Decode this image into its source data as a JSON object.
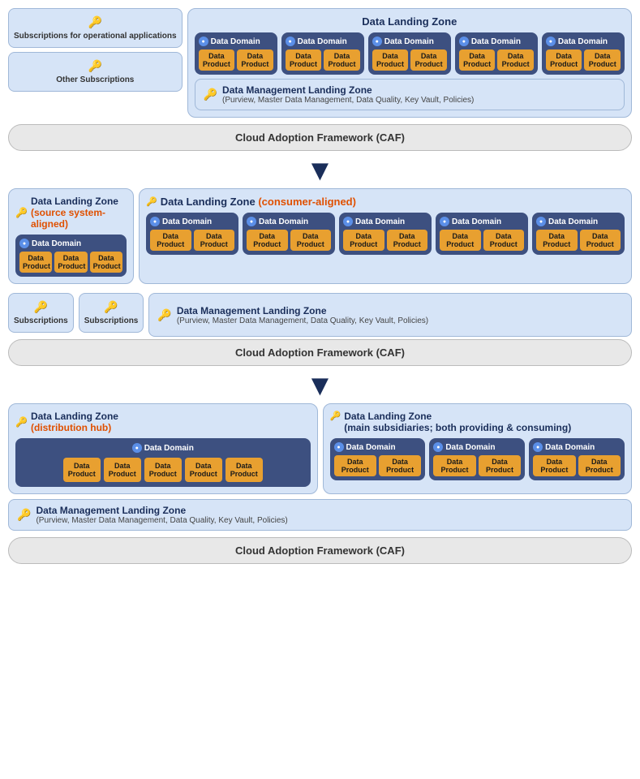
{
  "section1": {
    "sub1_label": "Subscriptions for operational applications",
    "sub2_label": "Other Subscriptions",
    "dlz_title": "Data Landing Zone",
    "domains": [
      {
        "label": "Data Domain",
        "products": [
          "Data Product",
          "Data Product"
        ]
      },
      {
        "label": "Data Domain",
        "products": [
          "Data Product",
          "Data Product"
        ]
      },
      {
        "label": "Data Domain",
        "products": [
          "Data Product",
          "Data Product"
        ]
      },
      {
        "label": "Data Domain",
        "products": [
          "Data Product",
          "Data Product"
        ]
      },
      {
        "label": "Data Domain",
        "products": [
          "Data Product",
          "Data Product"
        ]
      }
    ],
    "mgmt_title": "Data Management Landing Zone",
    "mgmt_sub": "(Purview, Master Data Management, Data Quality, Key Vault, Policies)"
  },
  "caf1": "Cloud Adoption Framework (CAF)",
  "section2": {
    "left_title": "Data Landing Zone",
    "left_subtitle": "(source system-aligned)",
    "left_domains": [
      {
        "label": "Data Domain",
        "products": [
          "Data Product",
          "Data Product",
          "Data Product"
        ]
      }
    ],
    "right_title": "Data Landing Zone",
    "right_subtitle": "(consumer-aligned)",
    "right_domains": [
      {
        "label": "Data Domain",
        "products": [
          "Data Product",
          "Data Product"
        ]
      },
      {
        "label": "Data Domain",
        "products": [
          "Data Product",
          "Data Product"
        ]
      },
      {
        "label": "Data Domain",
        "products": [
          "Data Product",
          "Data Product"
        ]
      },
      {
        "label": "Data Domain",
        "products": [
          "Data Product",
          "Data Product"
        ]
      },
      {
        "label": "Data Domain",
        "products": [
          "Data Product",
          "Data Product"
        ]
      }
    ],
    "sub1_label": "Subscriptions",
    "sub2_label": "Subscriptions",
    "mgmt_title": "Data Management Landing Zone",
    "mgmt_sub": "(Purview, Master Data Management, Data Quality, Key Vault, Policies)"
  },
  "caf2": "Cloud Adoption Framework (CAF)",
  "section3": {
    "left_title": "Data Landing Zone",
    "left_subtitle": "(distribution hub)",
    "left_domain_label": "Data Domain",
    "left_products": [
      "Data Product",
      "Data Product",
      "Data Product",
      "Data Product",
      "Data Product"
    ],
    "right_title": "Data Landing Zone",
    "right_subtitle": "(main subsidiaries; both providing & consuming)",
    "right_domains": [
      {
        "label": "Data Domain",
        "products": [
          "Data Product",
          "Data Product"
        ]
      },
      {
        "label": "Data Domain",
        "products": [
          "Data Product",
          "Data Product"
        ]
      },
      {
        "label": "Data Domain",
        "products": [
          "Data Product",
          "Data Product"
        ]
      }
    ],
    "mgmt_title": "Data Management Landing Zone",
    "mgmt_sub": "(Purview, Master Data Management, Data Quality, Key Vault, Policies)"
  },
  "caf3": "Cloud Adoption Framework (CAF)",
  "key_emoji": "🔑"
}
